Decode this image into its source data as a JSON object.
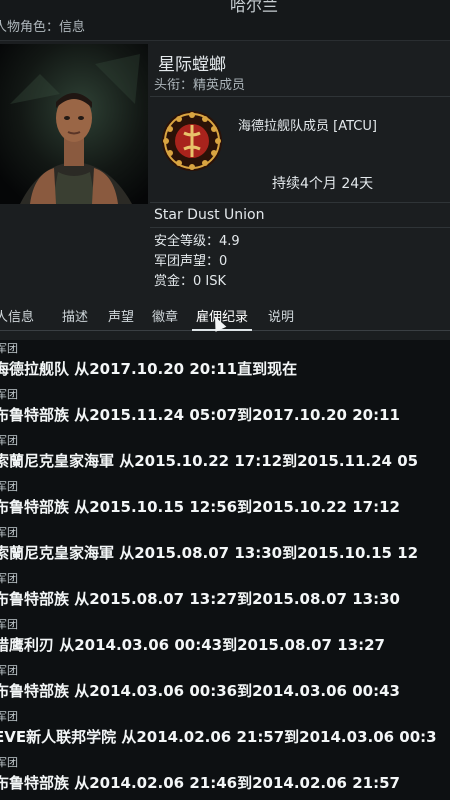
{
  "header": {
    "role_label": "人物角色：信息",
    "center_title": "哈尔兰"
  },
  "character": {
    "name": "星际螳螂",
    "subtitle": "头衔：精英成员"
  },
  "corporation": {
    "name": "海德拉舰队成员 [ATCU]",
    "duration": "持续4个月 24天"
  },
  "alliance": {
    "name": "Star Dust Union"
  },
  "stats": {
    "security_status": "安全等级：4.9",
    "faction_standing": "军团声望：0",
    "bounty": "赏金：0 ISK"
  },
  "tabs": [
    {
      "label": "个人信息"
    },
    {
      "label": "描述"
    },
    {
      "label": "声望"
    },
    {
      "label": "徽章"
    },
    {
      "label": "雇佣纪录"
    },
    {
      "label": "说明"
    }
  ],
  "employment_history": [
    {
      "label": "军团",
      "text": "海德拉舰队 从2017.10.20 20:11直到现在"
    },
    {
      "label": "军团",
      "text": "布鲁特部族 从2015.11.24 05:07到2017.10.20 20:11"
    },
    {
      "label": "军团",
      "text": "索蘭尼克皇家海軍 从2015.10.22 17:12到2015.11.24 05"
    },
    {
      "label": "军团",
      "text": "布鲁特部族 从2015.10.15 12:56到2015.10.22 17:12"
    },
    {
      "label": "军团",
      "text": "索蘭尼克皇家海軍 从2015.08.07 13:30到2015.10.15 12"
    },
    {
      "label": "军团",
      "text": "布鲁特部族 从2015.08.07 13:27到2015.08.07 13:30"
    },
    {
      "label": "军团",
      "text": "猎鹰利刃 从2014.03.06 00:43到2015.08.07 13:27"
    },
    {
      "label": "军团",
      "text": "布鲁特部族 从2014.03.06 00:36到2014.03.06 00:43"
    },
    {
      "label": "军团",
      "text": "EVE新人联邦学院 从2014.02.06 21:57到2014.03.06 00:3"
    },
    {
      "label": "军团",
      "text": "布鲁特部族 从2014.02.06 21:46到2014.02.06 21:57"
    }
  ],
  "colors": {
    "background": "#0d1012",
    "panel": "#1b1e20",
    "text": "#e8ecee",
    "logo_gold": "#d9a441",
    "logo_red": "#a8231c"
  }
}
